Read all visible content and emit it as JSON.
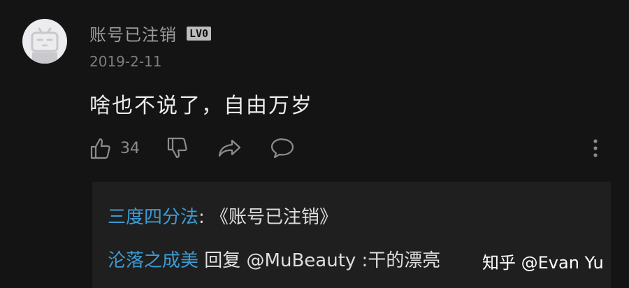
{
  "comment": {
    "username": "账号已注销",
    "level_badge": "LV0",
    "date": "2019-2-11",
    "text": "啥也不说了，自由万岁",
    "like_count": "34",
    "icons": [
      "thumbs-up-icon",
      "thumbs-down-icon",
      "share-icon",
      "comment-icon",
      "more-vertical-icon"
    ]
  },
  "replies": [
    {
      "author": "三度四分法",
      "separator": ": ",
      "content": "《账号已注销》"
    },
    {
      "author": "沦落之成美",
      "separator": " ",
      "content": "回复 @MuBeauty :干的漂亮"
    }
  ],
  "watermark": "知乎 @Evan Yu",
  "colors": {
    "background": "#141414",
    "reply_background": "#1f1f1f",
    "reply_author": "#3c9bd3",
    "muted_text": "#8c8c8c"
  }
}
